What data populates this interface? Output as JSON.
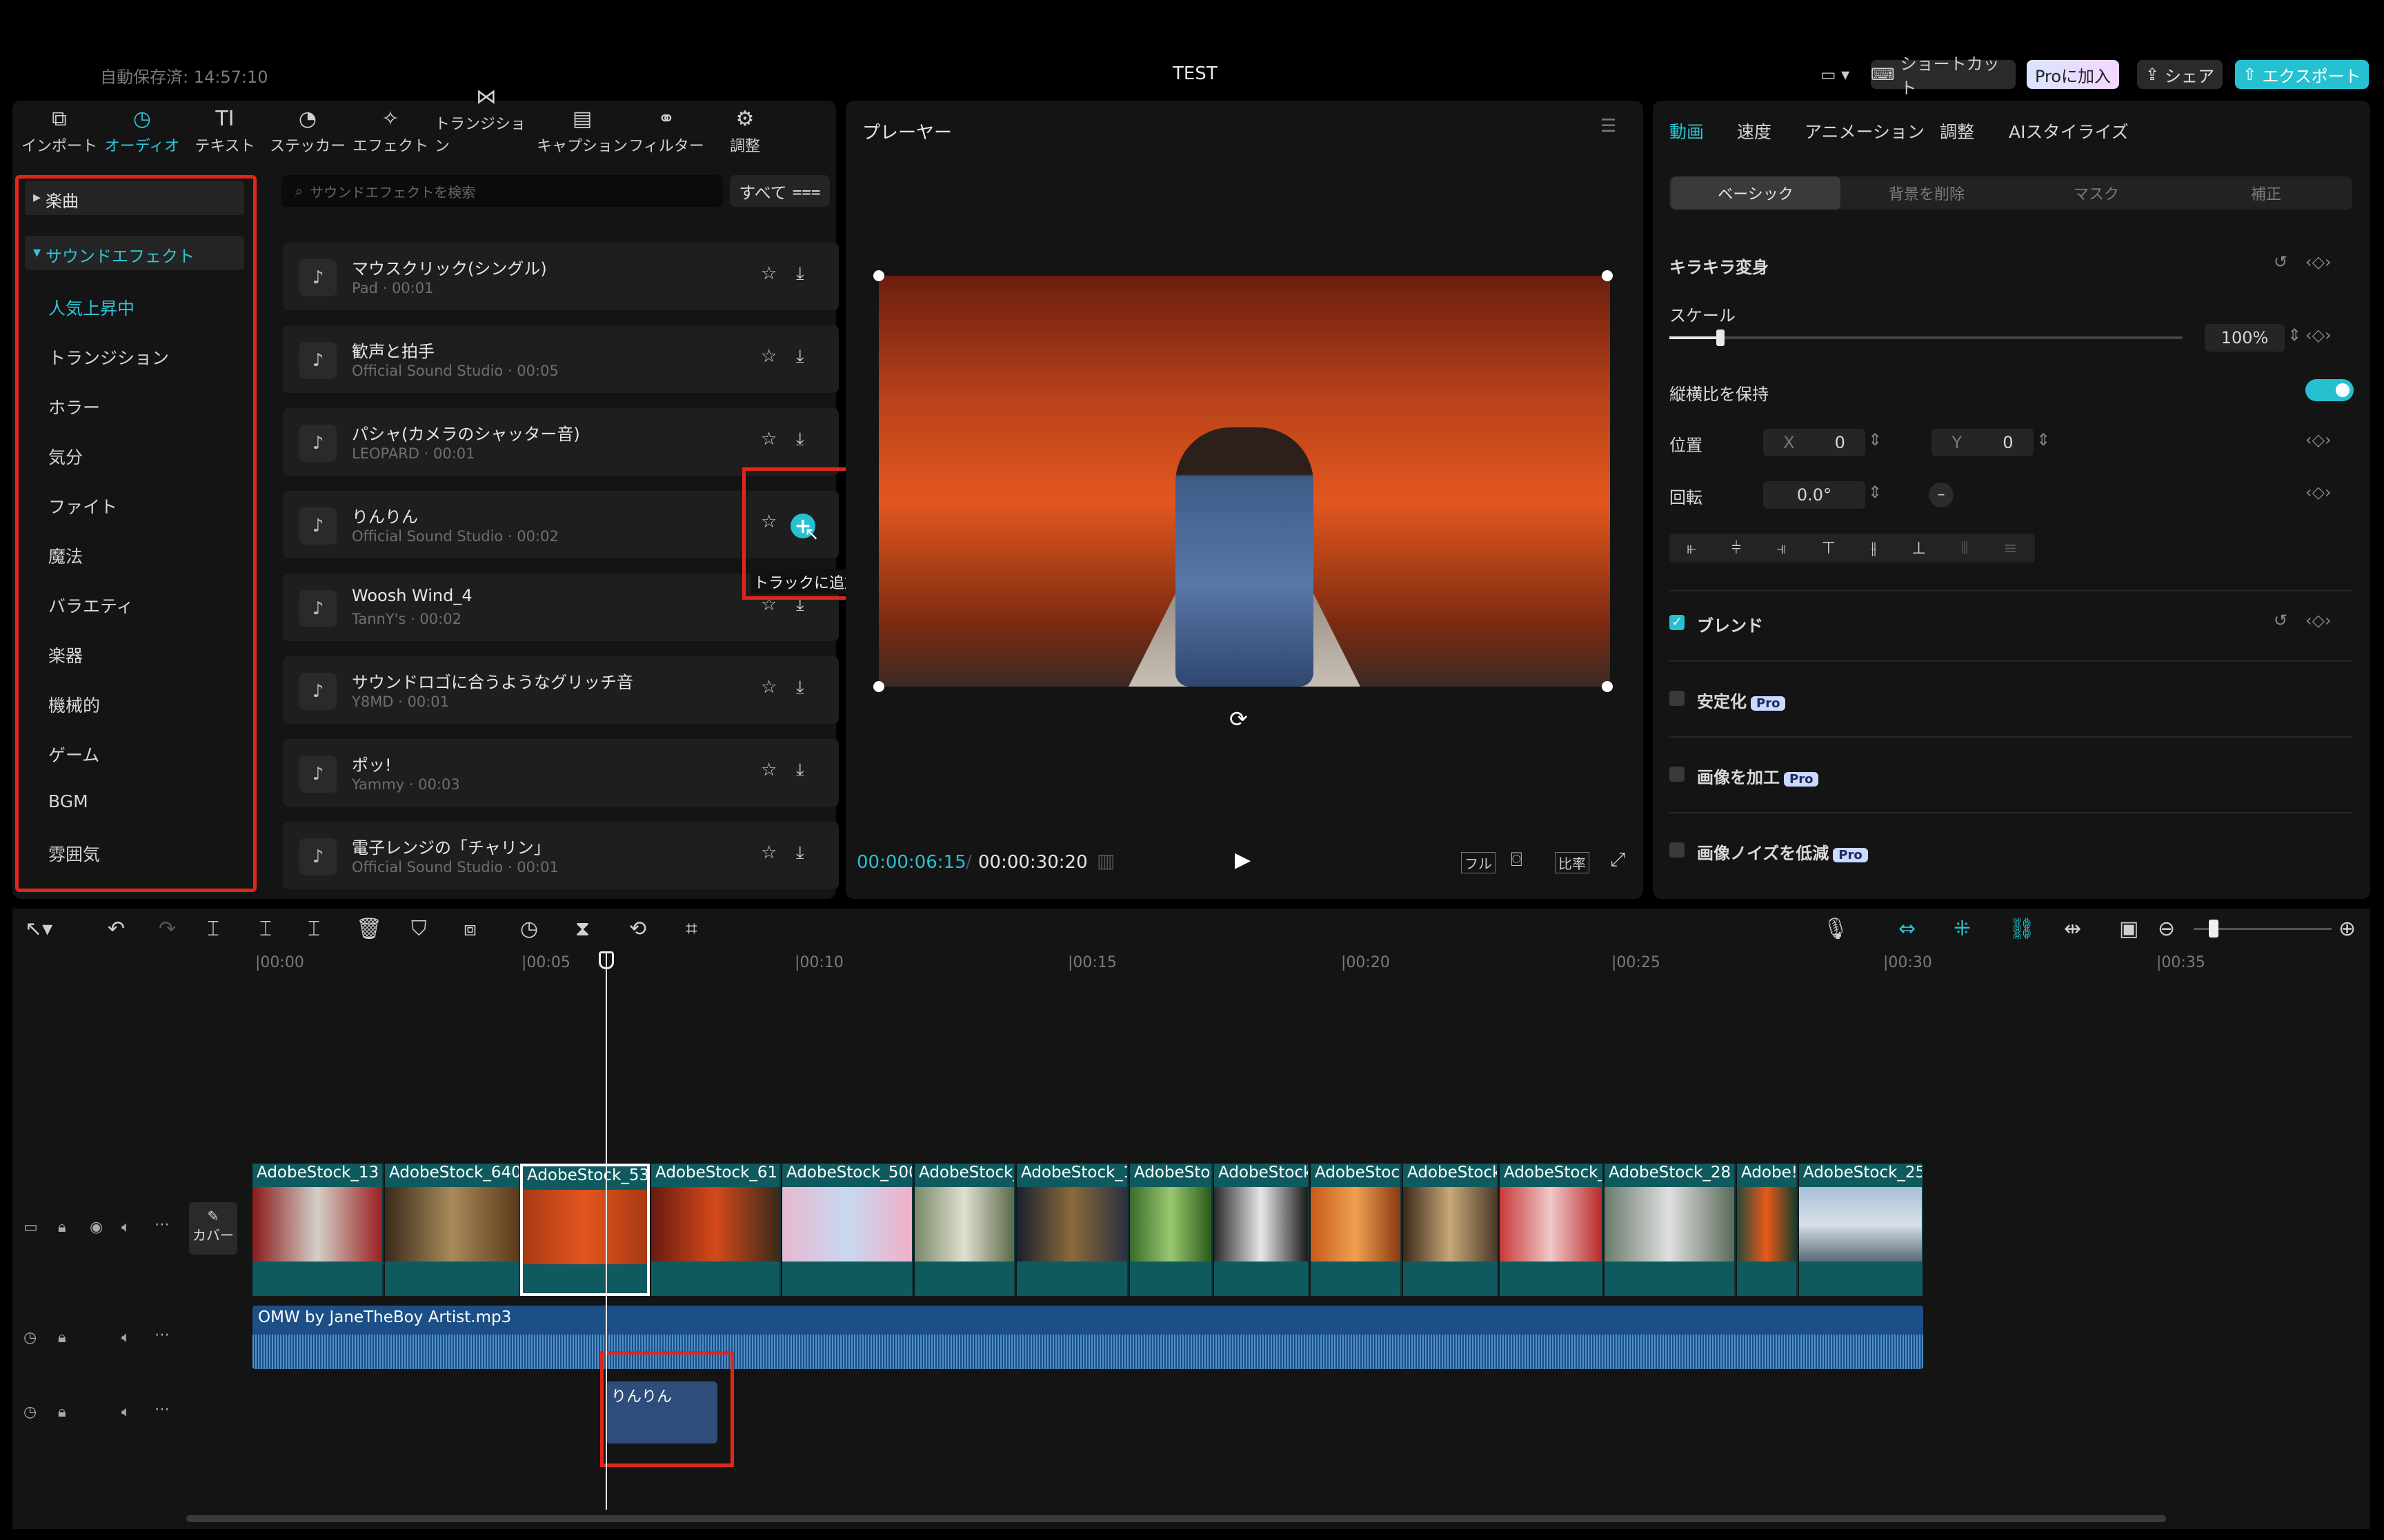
{
  "topbar": {
    "autosave": "自動保存済: 14:57:10",
    "title": "TEST",
    "shortcut": "ショートカット",
    "pro": "Proに加入",
    "share": "シェア",
    "export": "エクスポート"
  },
  "tools": [
    {
      "label": "インポート",
      "icon": "import-icon"
    },
    {
      "label": "オーディオ",
      "icon": "audio-icon"
    },
    {
      "label": "テキスト",
      "icon": "text-icon",
      "glyph": "TI"
    },
    {
      "label": "ステッカー",
      "icon": "sticker-icon"
    },
    {
      "label": "エフェクト",
      "icon": "effect-icon"
    },
    {
      "label": "トランジション",
      "icon": "transition-icon"
    },
    {
      "label": "キャプション",
      "icon": "caption-icon"
    },
    {
      "label": "フィルター",
      "icon": "filter-icon"
    },
    {
      "label": "調整",
      "icon": "adjust-icon"
    }
  ],
  "categories": {
    "music": "楽曲",
    "sfx": "サウンドエフェクト",
    "items": [
      "人気上昇中",
      "トランジション",
      "ホラー",
      "気分",
      "ファイト",
      "魔法",
      "バラエティ",
      "楽器",
      "機械的",
      "ゲーム",
      "BGM",
      "雰囲気"
    ]
  },
  "search": {
    "placeholder": "サウンドエフェクトを検索",
    "filter": "すべて"
  },
  "sounds": [
    {
      "title": "マウスクリック(シングル)",
      "meta": "Pad · 00:01"
    },
    {
      "title": "歓声と拍手",
      "meta": "Official Sound Studio · 00:05"
    },
    {
      "title": "パシャ(カメラのシャッター音)",
      "meta": "LEOPARD · 00:01"
    },
    {
      "title": "りんりん",
      "meta": "Official Sound Studio · 00:02"
    },
    {
      "title": "Woosh Wind_4",
      "meta": "TannY's · 00:02"
    },
    {
      "title": "サウンドロゴに合うようなグリッチ音",
      "meta": "Y8MD · 00:01"
    },
    {
      "title": "ポッ!",
      "meta": "Yammy · 00:03"
    },
    {
      "title": "電子レンジの「チャリン」",
      "meta": "Official Sound Studio · 00:01"
    }
  ],
  "tooltip": "トラックに追加",
  "player": {
    "title": "プレーヤー",
    "current": "00:00:06:15",
    "total": "00:00:30:20",
    "full": "フル",
    "ratio": "比率"
  },
  "inspector": {
    "tabs": [
      "動画",
      "速度",
      "アニメーション",
      "調整",
      "AIスタイライズ"
    ],
    "segments": [
      "ベーシック",
      "背景を削除",
      "マスク",
      "補正"
    ],
    "section": "キラキラ変身",
    "scale_label": "スケール",
    "scale_value": "100%",
    "scale_fraction": 0.1,
    "aspect_label": "縦横比を保持",
    "position_label": "位置",
    "x_label": "X",
    "x_value": "0",
    "y_label": "Y",
    "y_value": "0",
    "rotation_label": "回転",
    "rotation_value": "0.0°",
    "blend": "ブレンド",
    "stabilize": "安定化",
    "enhance": "画像を加工",
    "denoise": "画像ノイズを低減",
    "pro_badge": "Pro"
  },
  "timeline": {
    "ruler": [
      "|00:00",
      "|00:05",
      "|00:10",
      "|00:15",
      "|00:20",
      "|00:25",
      "|00:30",
      "|00:35"
    ],
    "cover": "カバー",
    "clips": [
      "AdobeStock_13",
      "AdobeStock_640",
      "AdobeStock_53",
      "AdobeStock_61",
      "AdobeStock_500",
      "AdobeStock_",
      "AdobeStock_1",
      "AdobeStoc",
      "AdobeStock",
      "AdobeStoc",
      "AdobeStock_",
      "AdobeStock_",
      "AdobeStock_28",
      "Adobe!",
      "AdobeStock_25"
    ],
    "audio_main": "OMW by JaneTheBoy Artist.mp3",
    "sfx_clip": "りんりん"
  },
  "colors": {
    "accent": "#26c1d1",
    "highlight": "#e0261b",
    "pro": "#c9d9ff"
  }
}
